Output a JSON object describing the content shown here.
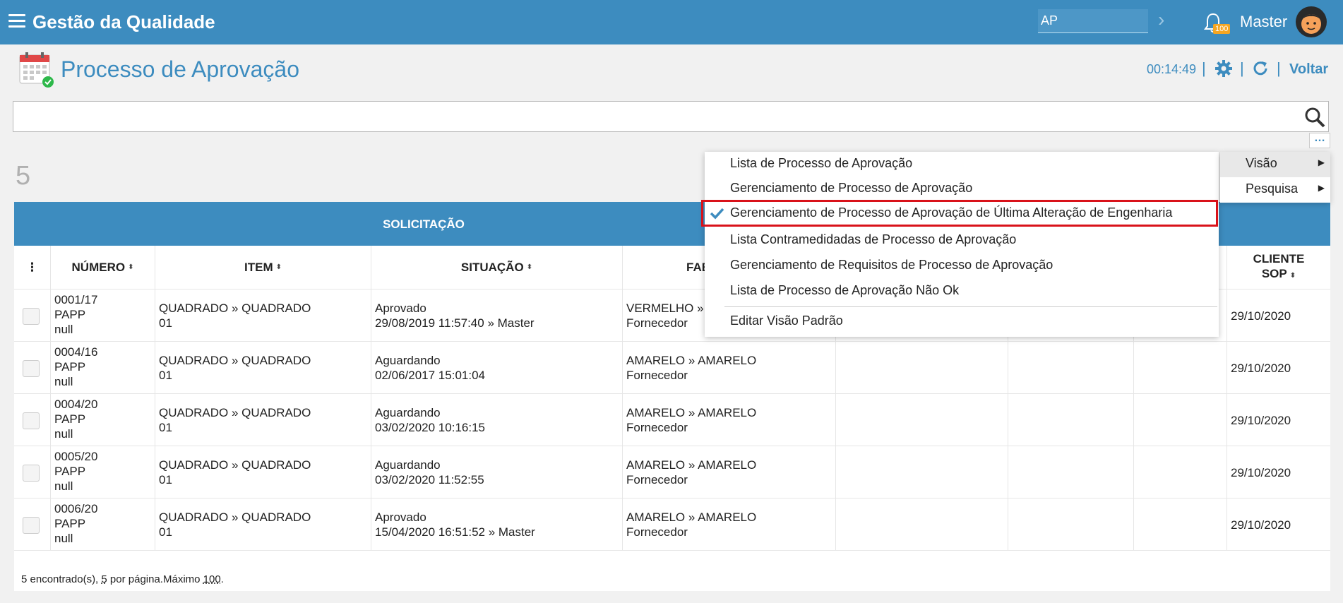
{
  "topbar": {
    "app_title": "Gestão da Qualidade",
    "search_value": "AP",
    "notification_count": "100",
    "user_name": "Master"
  },
  "header": {
    "title": "Processo de Aprovação",
    "timer": "00:14:49",
    "back_label": "Voltar"
  },
  "search": {
    "value": ""
  },
  "result_count": "5",
  "table": {
    "group_label": "SOLICITAÇÃO",
    "columns": {
      "numero": "NÚMERO",
      "item": "ITEM",
      "situacao": "SITUAÇÃO",
      "fab": "FAB",
      "cliente_sop_1": "CLIENTE",
      "cliente_sop_2": "SOP"
    },
    "rows": [
      {
        "numero": [
          "0001/17",
          "PAPP",
          "null"
        ],
        "item": [
          "QUADRADO » QUADRADO",
          "01"
        ],
        "situacao": [
          "Aprovado",
          "29/08/2019 11:57:40 » Master"
        ],
        "fab": [
          "VERMELHO » V",
          "Fornecedor"
        ],
        "sop": "29/10/2020"
      },
      {
        "numero": [
          "0004/16",
          "PAPP",
          "null"
        ],
        "item": [
          "QUADRADO » QUADRADO",
          "01"
        ],
        "situacao": [
          "Aguardando",
          "02/06/2017 15:01:04"
        ],
        "fab": [
          "AMARELO » AMARELO",
          "Fornecedor"
        ],
        "sop": "29/10/2020"
      },
      {
        "numero": [
          "0004/20",
          "PAPP",
          "null"
        ],
        "item": [
          "QUADRADO » QUADRADO",
          "01"
        ],
        "situacao": [
          "Aguardando",
          "03/02/2020 10:16:15"
        ],
        "fab": [
          "AMARELO » AMARELO",
          "Fornecedor"
        ],
        "sop": "29/10/2020"
      },
      {
        "numero": [
          "0005/20",
          "PAPP",
          "null"
        ],
        "item": [
          "QUADRADO » QUADRADO",
          "01"
        ],
        "situacao": [
          "Aguardando",
          "03/02/2020 11:52:55"
        ],
        "fab": [
          "AMARELO » AMARELO",
          "Fornecedor"
        ],
        "sop": "29/10/2020"
      },
      {
        "numero": [
          "0006/20",
          "PAPP",
          "null"
        ],
        "item": [
          "QUADRADO » QUADRADO",
          "01"
        ],
        "situacao": [
          "Aprovado",
          "15/04/2020 16:51:52 » Master"
        ],
        "fab": [
          "AMARELO » AMARELO",
          "Fornecedor"
        ],
        "sop": "29/10/2020"
      }
    ],
    "footer": {
      "found_prefix": "5 encontrado(s), ",
      "per_page": "5",
      "per_page_suffix": " por página.Máximo ",
      "max": "100",
      "end": "."
    }
  },
  "menu": {
    "items": [
      "Lista de Processo de Aprovação",
      "Gerenciamento de Processo de Aprovação",
      "Gerenciamento de Processo de Aprovação de Última Alteração de Engenharia",
      "Lista Contramedidadas de Processo de Aprovação",
      "Gerenciamento de Requisitos de Processo de Aprovação",
      "Lista de Processo de Aprovação Não Ok"
    ],
    "selected_index": 2,
    "edit_default": "Editar Visão Padrão"
  },
  "submenu": {
    "items": [
      "Visão",
      "Pesquisa"
    ],
    "active_index": 0
  },
  "colors": {
    "primary": "#3d8cbf",
    "highlight_border": "#d9121a",
    "badge": "#f5a623"
  }
}
